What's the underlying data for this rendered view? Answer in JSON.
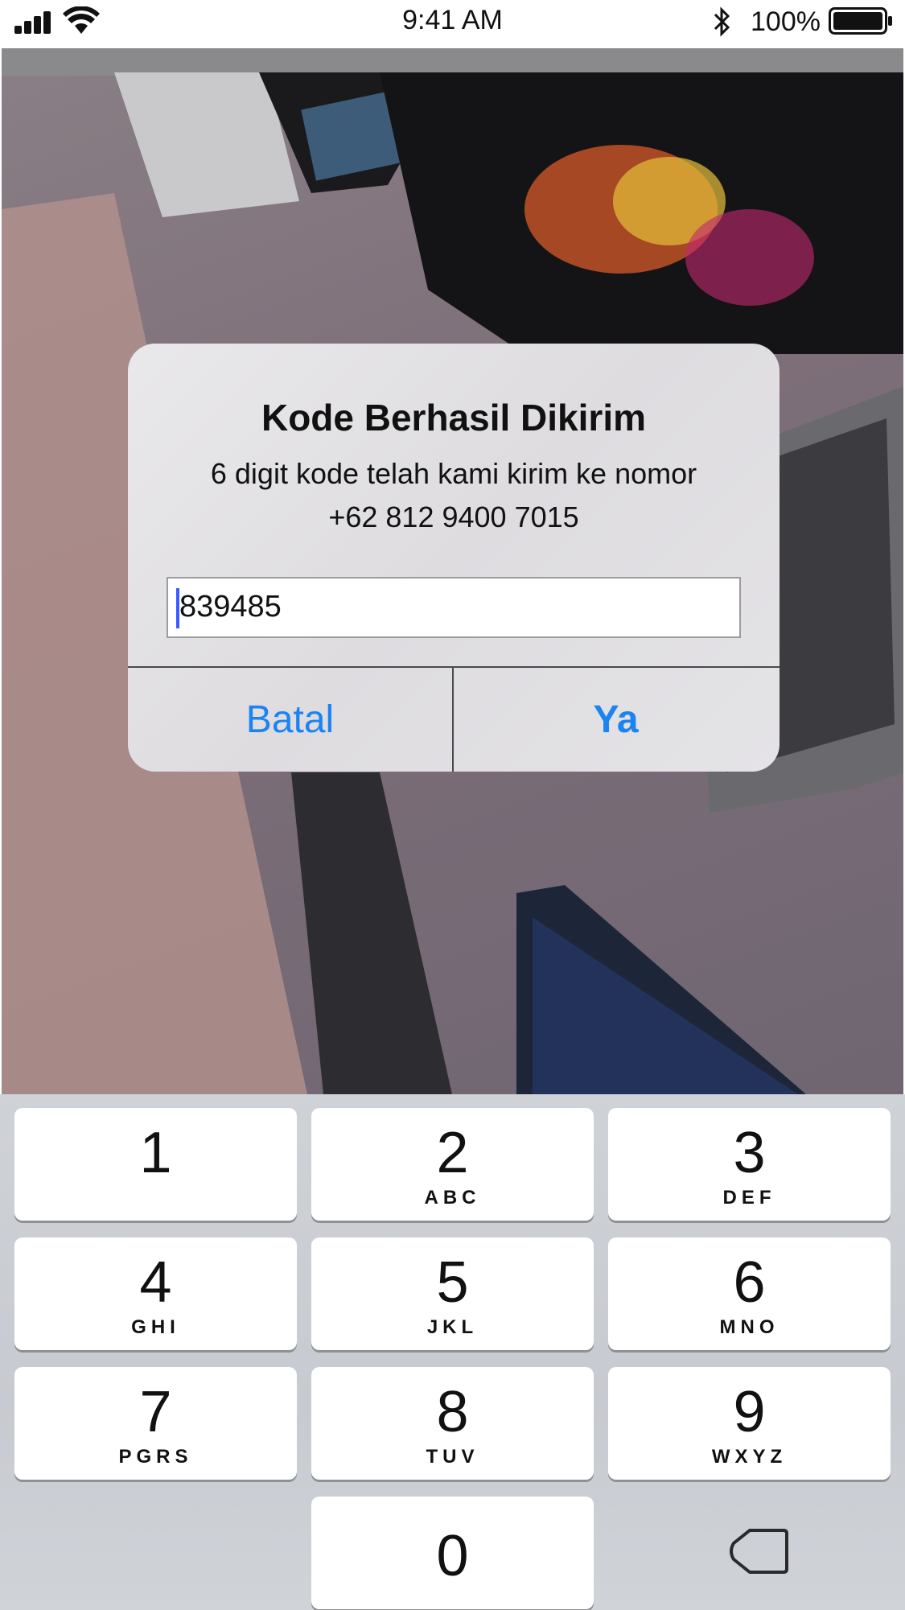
{
  "status_bar": {
    "time": "9:41 AM",
    "battery_percent": "100%",
    "icons": [
      "signal-icon",
      "wifi-icon",
      "bluetooth-icon",
      "battery-icon"
    ],
    "battery_level": 1.0
  },
  "dialog": {
    "title": "Kode Berhasil Dikirim",
    "message_line1": "6 digit kode telah kami kirim ke nomor",
    "message_line2": "+62 812 9400 7015",
    "input_value": "839485",
    "cancel_label": "Batal",
    "ok_label": "Ya",
    "accent_color": "#1b84f0"
  },
  "keypad": {
    "keys": [
      {
        "num": "1",
        "letters": ""
      },
      {
        "num": "2",
        "letters": "ABC"
      },
      {
        "num": "3",
        "letters": "DEF"
      },
      {
        "num": "4",
        "letters": "GHI"
      },
      {
        "num": "5",
        "letters": "JKL"
      },
      {
        "num": "6",
        "letters": "MNO"
      },
      {
        "num": "7",
        "letters": "PGRS"
      },
      {
        "num": "8",
        "letters": "TUV"
      },
      {
        "num": "9",
        "letters": "WXYZ"
      },
      {
        "num": "0",
        "letters": ""
      }
    ],
    "delete_icon": "backspace-icon"
  }
}
